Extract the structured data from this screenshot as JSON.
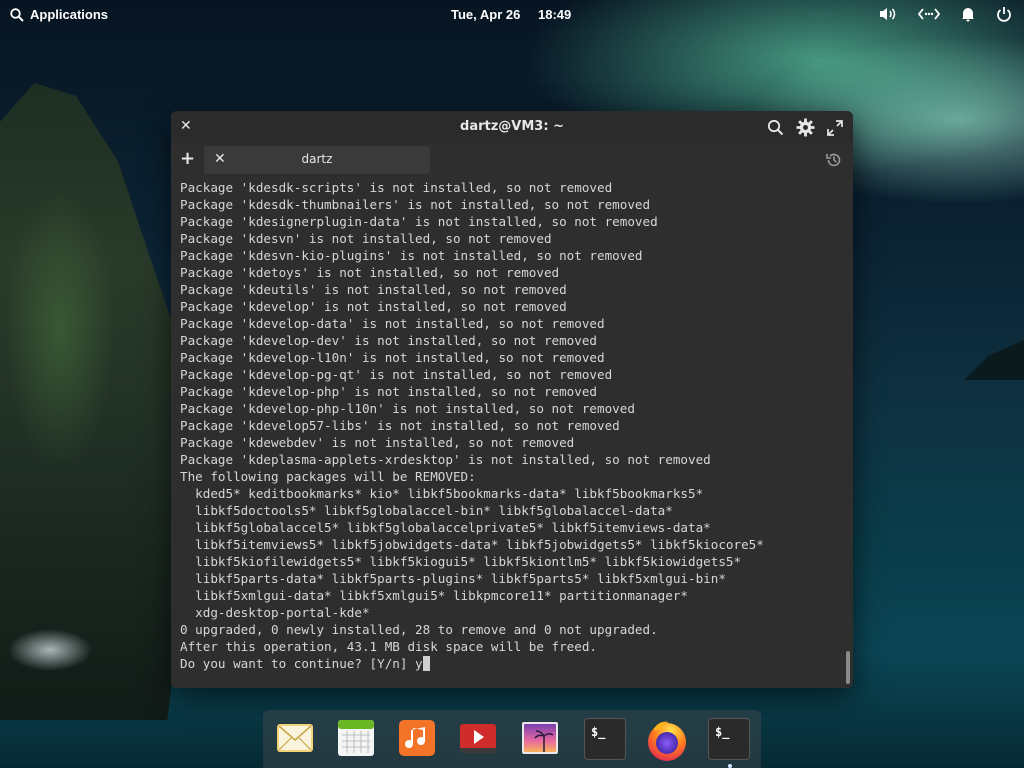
{
  "topbar": {
    "applications_label": "Applications",
    "date": "Tue, Apr 26",
    "time": "18:49",
    "tray_icons": [
      "volume-icon",
      "network-icon",
      "notifications-icon",
      "power-icon"
    ]
  },
  "window": {
    "title": "dartz@VM3: ~",
    "tab_label": "dartz"
  },
  "terminal": {
    "lines": [
      "Package 'kdesdk-scripts' is not installed, so not removed",
      "Package 'kdesdk-thumbnailers' is not installed, so not removed",
      "Package 'kdesignerplugin-data' is not installed, so not removed",
      "Package 'kdesvn' is not installed, so not removed",
      "Package 'kdesvn-kio-plugins' is not installed, so not removed",
      "Package 'kdetoys' is not installed, so not removed",
      "Package 'kdeutils' is not installed, so not removed",
      "Package 'kdevelop' is not installed, so not removed",
      "Package 'kdevelop-data' is not installed, so not removed",
      "Package 'kdevelop-dev' is not installed, so not removed",
      "Package 'kdevelop-l10n' is not installed, so not removed",
      "Package 'kdevelop-pg-qt' is not installed, so not removed",
      "Package 'kdevelop-php' is not installed, so not removed",
      "Package 'kdevelop-php-l10n' is not installed, so not removed",
      "Package 'kdevelop57-libs' is not installed, so not removed",
      "Package 'kdewebdev' is not installed, so not removed",
      "Package 'kdeplasma-applets-xrdesktop' is not installed, so not removed",
      "The following packages will be REMOVED:",
      "  kded5* keditbookmarks* kio* libkf5bookmarks-data* libkf5bookmarks5*",
      "  libkf5doctools5* libkf5globalaccel-bin* libkf5globalaccel-data*",
      "  libkf5globalaccel5* libkf5globalaccelprivate5* libkf5itemviews-data*",
      "  libkf5itemviews5* libkf5jobwidgets-data* libkf5jobwidgets5* libkf5kiocore5*",
      "  libkf5kiofilewidgets5* libkf5kiogui5* libkf5kiontlm5* libkf5kiowidgets5*",
      "  libkf5parts-data* libkf5parts-plugins* libkf5parts5* libkf5xmlgui-bin*",
      "  libkf5xmlgui-data* libkf5xmlgui5* libkpmcore11* partitionmanager*",
      "  xdg-desktop-portal-kde*",
      "0 upgraded, 0 newly installed, 28 to remove and 0 not upgraded.",
      "After this operation, 43.1 MB disk space will be freed."
    ],
    "prompt": "Do you want to continue? [Y/n] y"
  },
  "dock": {
    "apps": [
      "mail-icon",
      "calendar-icon",
      "music-icon",
      "videos-icon",
      "photos-icon",
      "terminal-icon",
      "firefox-icon",
      "terminal-icon"
    ],
    "terminal_glyph": "$_"
  }
}
